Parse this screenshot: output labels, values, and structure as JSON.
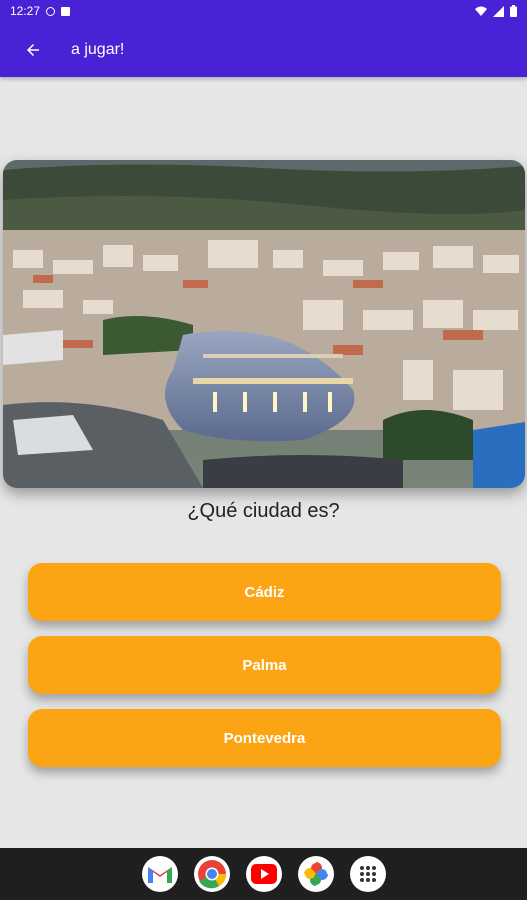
{
  "status_bar": {
    "time": "12:27"
  },
  "app_bar": {
    "title": "a jugar!",
    "back_icon": "arrow-back-icon"
  },
  "quiz": {
    "image_alt_icon": "city-photo",
    "question": "¿Qué ciudad es?",
    "answers": [
      "Cádiz",
      "Palma",
      "Pontevedra"
    ]
  },
  "taskbar": {
    "apps": [
      "gmail-icon",
      "chrome-icon",
      "youtube-icon",
      "photos-icon",
      "app-drawer-icon"
    ]
  },
  "colors": {
    "primary": "#4a22d6",
    "answer_button": "#fca514",
    "background": "#e6e6e6",
    "taskbar": "#1f1f1f"
  }
}
